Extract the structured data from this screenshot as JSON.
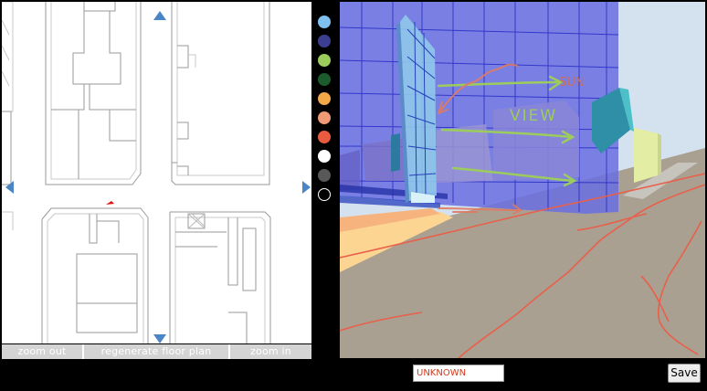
{
  "plan_toolbar": {
    "zoom_out_label": "zoom out",
    "regenerate_label": "regenerate floor plan",
    "zoom_in_label": "zoom in"
  },
  "palette": {
    "colors": [
      "#7ec1ee",
      "#3c3f8f",
      "#9ccc5c",
      "#1c5c2c",
      "#f3a94a",
      "#f09a76",
      "#e85b3f",
      "#ffffff",
      "#585858",
      "#000000"
    ]
  },
  "status": {
    "value": "UNKNOWN",
    "color": "#d03a1c"
  },
  "save_label": "Save",
  "sketch": {
    "annotation_upper": "SUN",
    "annotation_lower": "VIEW"
  },
  "icons": {
    "pan_up": "triangle-up-icon",
    "pan_down": "triangle-down-icon",
    "pan_left": "triangle-left-icon",
    "pan_right": "triangle-right-icon"
  },
  "accent": "#4a86c6"
}
